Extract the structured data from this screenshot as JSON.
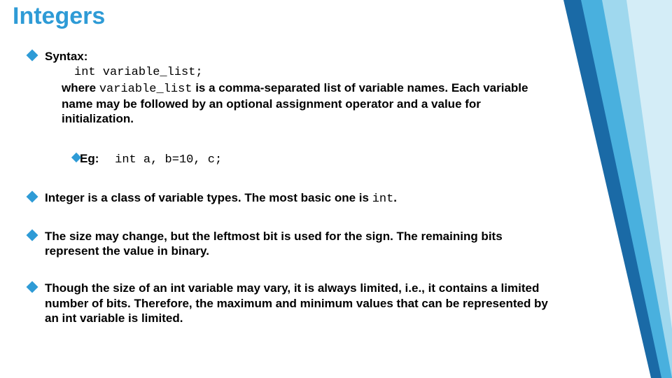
{
  "title": "Integers",
  "b1": {
    "syntax_label": "Syntax:",
    "code_line": "int variable_list;",
    "desc_pre": "where ",
    "desc_code": "variable_list",
    "desc_post": " is a comma-separated list of variable names. Each variable name may be followed by an optional assignment operator and a value for initialization.",
    "eg_label": "Eg:",
    "eg_code": "int a, b=10, c;"
  },
  "b2_pre": "Integer is a class of variable types. The most basic one is ",
  "b2_code": "int",
  "b2_post": ".",
  "b3": "The size may change, but the leftmost bit is used for the sign. The remaining bits represent the value in binary.",
  "b4": "Though the size of an int variable may vary, it is always limited, i.e., it contains a limited number of bits. Therefore, the maximum and minimum values that can be represented by an int variable is limited."
}
